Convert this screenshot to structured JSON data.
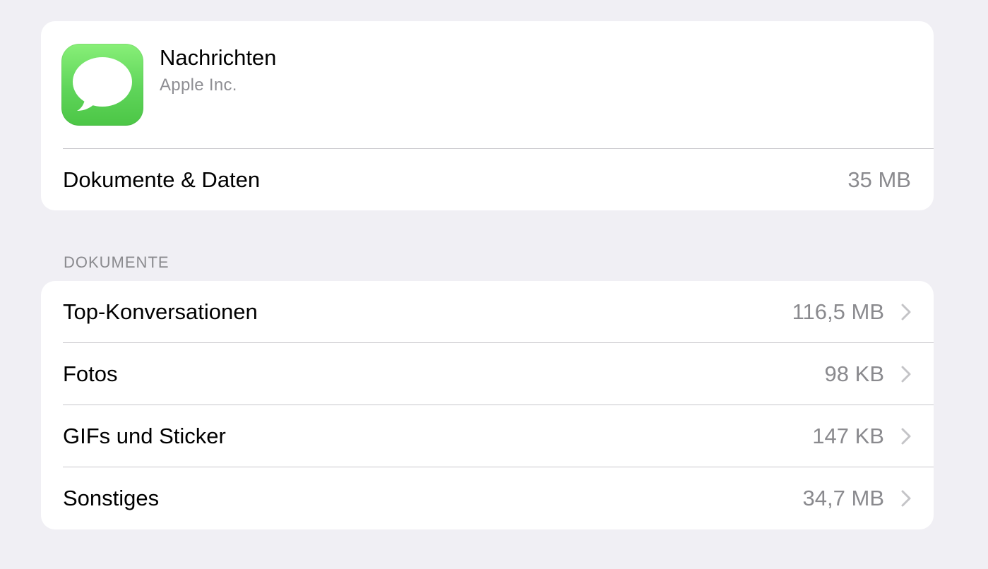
{
  "app": {
    "name": "Nachrichten",
    "developer": "Apple Inc.",
    "icon": "messages-app-icon",
    "icon_color": "#5fd55a"
  },
  "summary": {
    "label": "Dokumente & Daten",
    "value": "35 MB"
  },
  "documents": {
    "header": "DOKUMENTE",
    "items": [
      {
        "label": "Top-Konversationen",
        "value": "116,5 MB",
        "icon": "chevron-right-icon"
      },
      {
        "label": "Fotos",
        "value": "98 KB",
        "icon": "chevron-right-icon"
      },
      {
        "label": "GIFs und Sticker",
        "value": "147 KB",
        "icon": "chevron-right-icon"
      },
      {
        "label": "Sonstiges",
        "value": "34,7 MB",
        "icon": "chevron-right-icon"
      }
    ]
  },
  "colors": {
    "background": "#f0eff4",
    "card": "#ffffff",
    "secondary_text": "#8a8a8e",
    "separator": "#c8c7cc",
    "chevron": "#c4c4c7"
  }
}
